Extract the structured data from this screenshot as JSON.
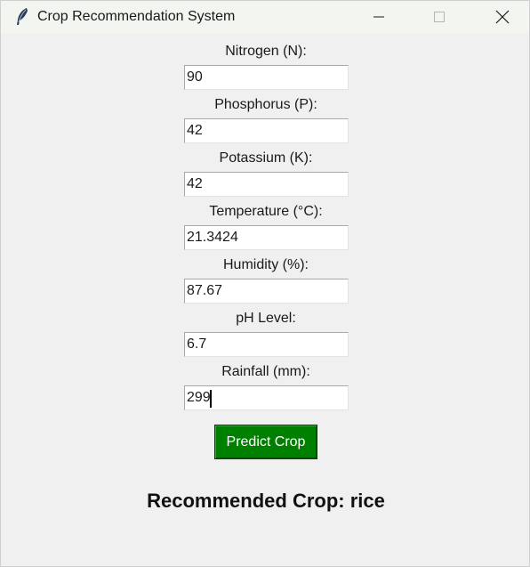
{
  "window": {
    "title": "Crop Recommendation System",
    "icon": "feather-icon",
    "controls": [
      "minimize-icon",
      "maximize-icon",
      "close-icon"
    ]
  },
  "fields": [
    {
      "label": "Nitrogen (N):",
      "value": "90"
    },
    {
      "label": "Phosphorus (P):",
      "value": "42"
    },
    {
      "label": "Potassium (K):",
      "value": "42"
    },
    {
      "label": "Temperature (°C):",
      "value": "21.3424"
    },
    {
      "label": "Humidity (%):",
      "value": "87.67"
    },
    {
      "label": "pH Level:",
      "value": "6.7"
    },
    {
      "label": "Rainfall (mm):",
      "value": "299"
    }
  ],
  "predict_button": {
    "label": "Predict Crop",
    "color": "#008000"
  },
  "result": {
    "text": "Recommended Crop: rice"
  }
}
